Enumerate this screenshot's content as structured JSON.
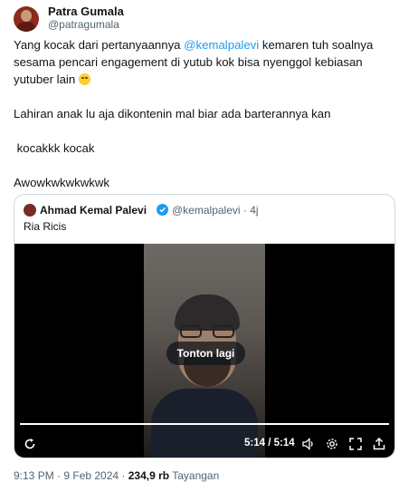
{
  "author": {
    "display_name": "Patra Gumala",
    "handle": "@patragumala"
  },
  "tweet": {
    "line1_before": "Yang kocak dari pertanyaannya ",
    "mention": "@kemalpalevi",
    "line1_after": " kemaren tuh soalnya sesama pencari engagement di yutub kok bisa nyenggol kebiasan yutuber lain ",
    "emoji": "grinning-sweat-emoji",
    "para2": "Lahiran anak lu aja dikontenin mal biar ada barterannya kan",
    "para3": " kocakkk kocak",
    "para4": "Awowkwkwkwkwk"
  },
  "quote": {
    "display_name": "Ahmad Kemal Palevi",
    "meta": "@kemalpalevi · 4j",
    "text": "Ria Ricis",
    "video": {
      "replay_label": "Tonton lagi",
      "time": "5:14 / 5:14",
      "progress": 1.0
    }
  },
  "footer": {
    "time": "9:13 PM · 9 Feb 2024 · ",
    "views": "234,9 rb",
    "views_label": " Tayangan"
  }
}
